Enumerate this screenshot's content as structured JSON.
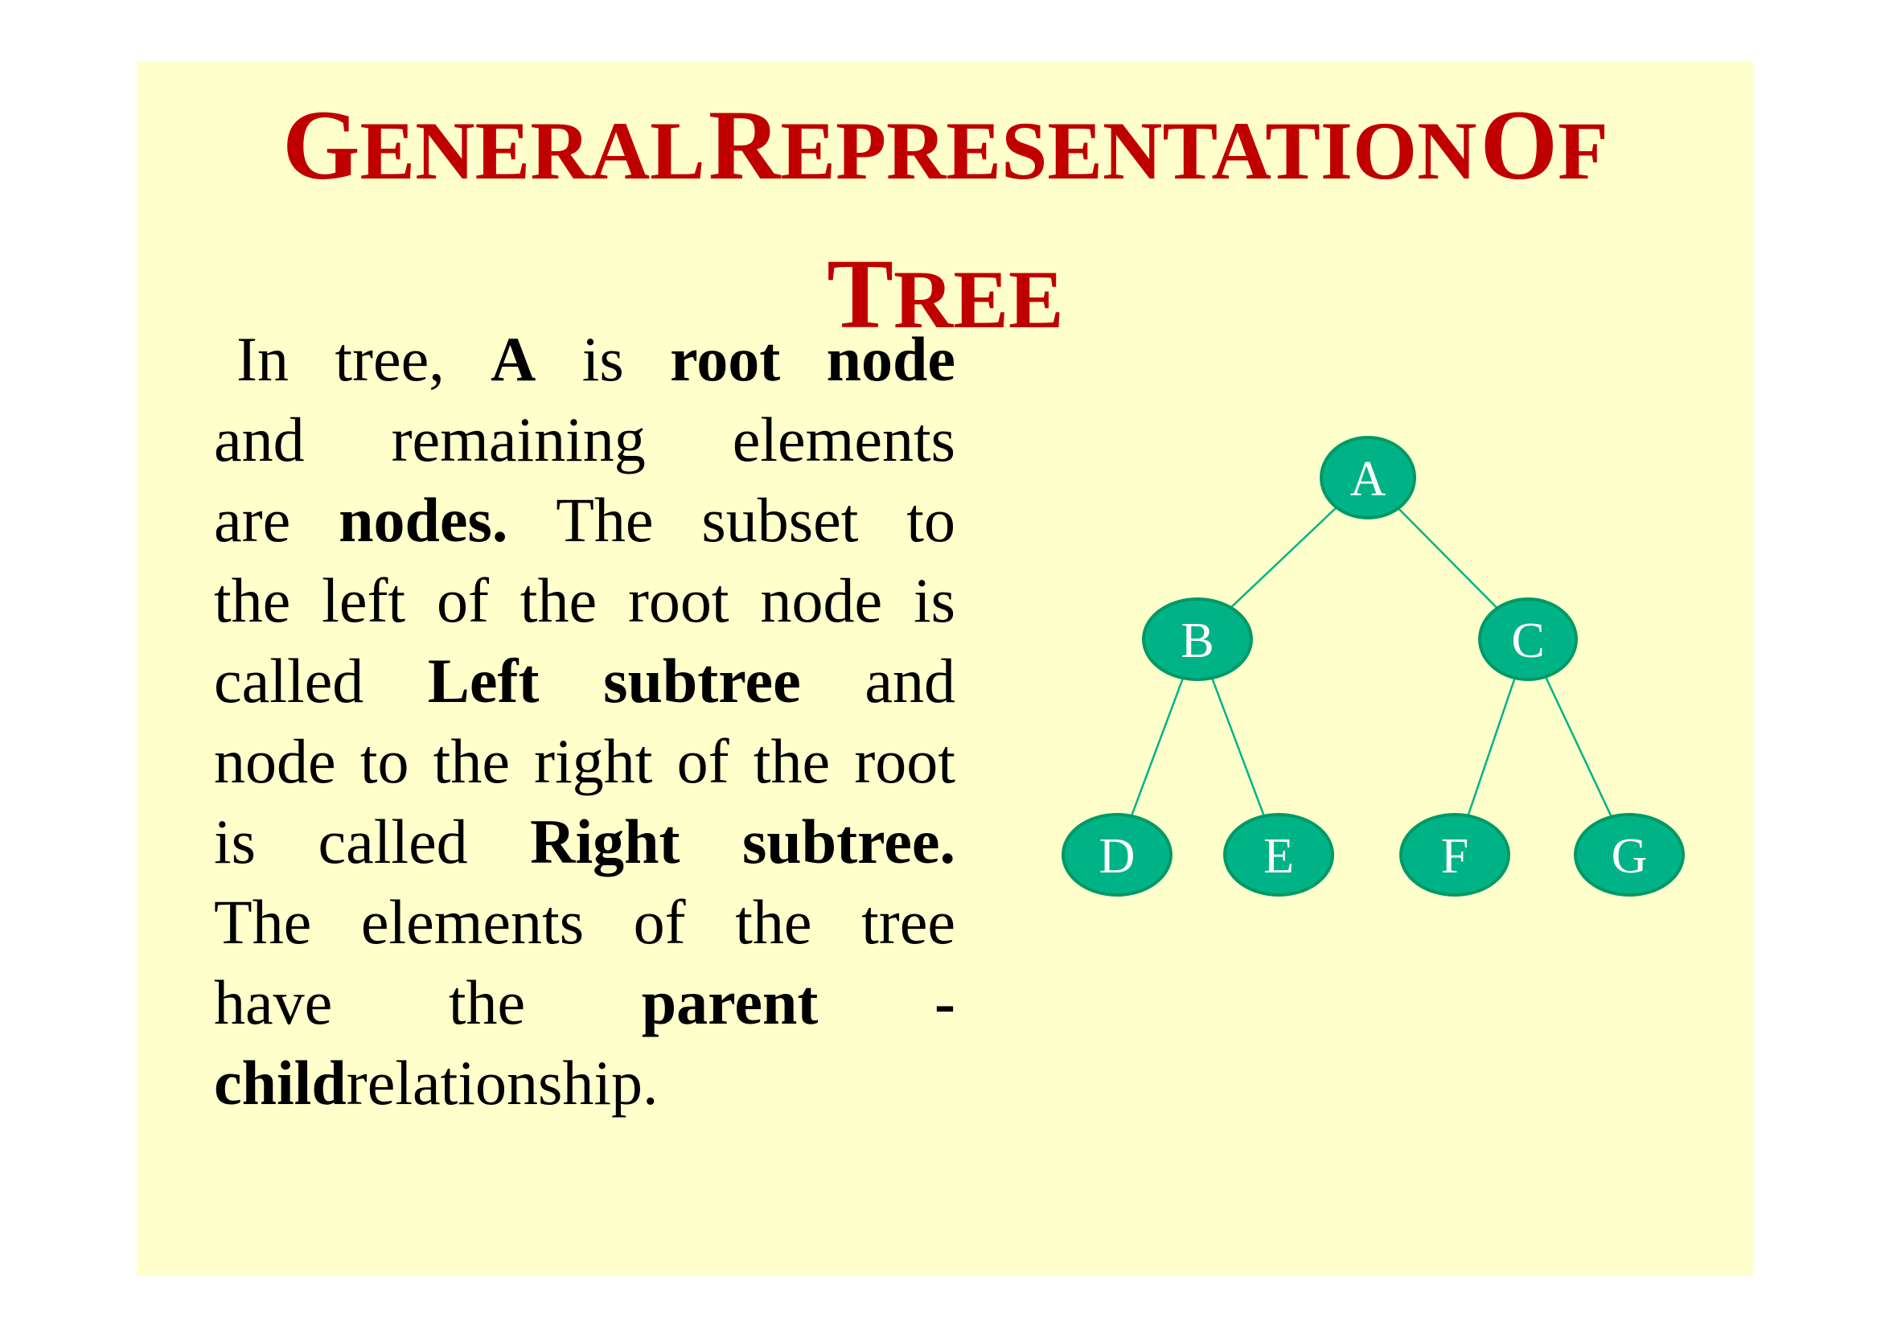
{
  "slide": {
    "title_line1_words": [
      {
        "cap": "G",
        "rest": "ENERAL"
      },
      {
        "cap": "R",
        "rest": "EPRESENTATION"
      },
      {
        "cap": "O",
        "rest": "F"
      }
    ],
    "title_line2_words": [
      {
        "cap": "T",
        "rest": "REE"
      }
    ],
    "background_color": "#ffffcc",
    "title_color": "#c00000"
  },
  "paragraph": {
    "rows": [
      [
        {
          "t": "In"
        },
        {
          "t": "tree,"
        },
        {
          "t": "A",
          "b": true
        },
        {
          "t": "is"
        },
        {
          "t": "root",
          "b": true
        },
        {
          "t": "node",
          "b": true
        }
      ],
      [
        {
          "t": "and"
        },
        {
          "t": "remaining"
        },
        {
          "t": "elements"
        }
      ],
      [
        {
          "t": "are"
        },
        {
          "t": "nodes.",
          "b": true
        },
        {
          "t": "The"
        },
        {
          "t": "subset"
        },
        {
          "t": "to"
        }
      ],
      [
        {
          "t": "the"
        },
        {
          "t": "left"
        },
        {
          "t": "of"
        },
        {
          "t": "the"
        },
        {
          "t": "root"
        },
        {
          "t": "node"
        },
        {
          "t": "is"
        }
      ],
      [
        {
          "t": "called"
        },
        {
          "t": "Left",
          "b": true
        },
        {
          "t": "subtree",
          "b": true
        },
        {
          "t": "and"
        }
      ],
      [
        {
          "t": "node"
        },
        {
          "t": "to"
        },
        {
          "t": "the"
        },
        {
          "t": "right"
        },
        {
          "t": "of"
        },
        {
          "t": "the"
        },
        {
          "t": "root"
        }
      ],
      [
        {
          "t": "is"
        },
        {
          "t": "called"
        },
        {
          "t": "Right",
          "b": true
        },
        {
          "t": "subtree.",
          "b": true
        }
      ],
      [
        {
          "t": "The"
        },
        {
          "t": "elements"
        },
        {
          "t": "of"
        },
        {
          "t": "the"
        },
        {
          "t": "tree"
        }
      ],
      [
        {
          "t": "have"
        },
        {
          "t": "the"
        },
        {
          "t": "parent",
          "b": true
        },
        {
          "t": "-",
          "b": true
        }
      ],
      [
        {
          "t": "child",
          "b": true
        },
        {
          "t": "relationship."
        }
      ]
    ]
  },
  "tree": {
    "node_color": "#00b386",
    "nodes": [
      {
        "id": "A",
        "label": "A"
      },
      {
        "id": "B",
        "label": "B"
      },
      {
        "id": "C",
        "label": "C"
      },
      {
        "id": "D",
        "label": "D"
      },
      {
        "id": "E",
        "label": "E"
      },
      {
        "id": "F",
        "label": "F"
      },
      {
        "id": "G",
        "label": "G"
      }
    ],
    "edges": [
      {
        "from": "A",
        "to": "B"
      },
      {
        "from": "A",
        "to": "C"
      },
      {
        "from": "B",
        "to": "D"
      },
      {
        "from": "B",
        "to": "E"
      },
      {
        "from": "C",
        "to": "F"
      },
      {
        "from": "C",
        "to": "G"
      }
    ]
  }
}
